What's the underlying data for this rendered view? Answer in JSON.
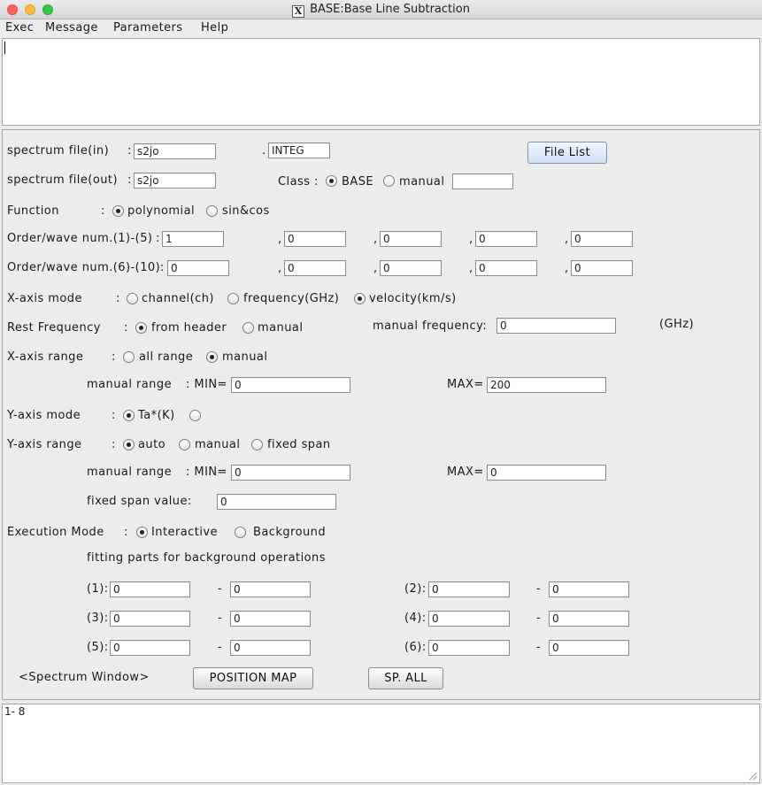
{
  "window": {
    "title": "BASE:Base Line Subtraction",
    "app_icon": "x-window-icon"
  },
  "menu": [
    "Exec",
    "Message",
    "Parameters",
    "Help"
  ],
  "log_top": "",
  "spectrum_in": {
    "label": "spectrum file(in)",
    "colon": ":",
    "value": "s2jo",
    "dot": ".",
    "ext": "INTEG"
  },
  "file_list_button": "File List",
  "spectrum_out": {
    "label": "spectrum file(out)",
    "colon": ":",
    "value": "s2jo"
  },
  "class": {
    "label": "Class :",
    "options": [
      "BASE",
      "manual"
    ],
    "selected": "BASE",
    "manual_value": ""
  },
  "function": {
    "label": "Function",
    "colon": ":",
    "options": [
      "polynomial",
      "sin&cos"
    ],
    "selected": "polynomial"
  },
  "order1": {
    "label": "Order/wave num.(1)-(5)",
    "colon": ":",
    "values": [
      "1",
      "0",
      "0",
      "0",
      "0"
    ]
  },
  "order2": {
    "label": "Order/wave num.(6)-(10)",
    "colon": ":",
    "values": [
      "0",
      "0",
      "0",
      "0",
      "0"
    ]
  },
  "comma": ",",
  "xaxis_mode": {
    "label": "X-axis mode",
    "colon": ":",
    "options": [
      "channel(ch)",
      "frequency(GHz)",
      "velocity(km/s)"
    ],
    "selected": "velocity(km/s)"
  },
  "rest_freq": {
    "label": "Rest Frequency",
    "colon": ":",
    "options": [
      "from header",
      "manual"
    ],
    "selected": "from header",
    "manual_label": "manual frequency:",
    "manual_value": "0",
    "unit": "(GHz)"
  },
  "xaxis_range": {
    "label": "X-axis range",
    "colon": ":",
    "options": [
      "all range",
      "manual"
    ],
    "selected": "manual",
    "manual_range_label": "manual range",
    "min_label": ": MIN=",
    "min": "0",
    "max_label": "MAX=",
    "max": "200"
  },
  "yaxis_mode": {
    "label": "Y-axis mode",
    "colon": ":",
    "options": [
      "Ta*(K)",
      ""
    ],
    "selected": "Ta*(K)"
  },
  "yaxis_range": {
    "label": "Y-axis range",
    "colon": ":",
    "options": [
      "auto",
      "manual",
      "fixed span"
    ],
    "selected": "auto",
    "manual_range_label": "manual range",
    "min_label": ": MIN=",
    "min": "0",
    "max_label": "MAX=",
    "max": "0",
    "fixed_span_label": "fixed span value:",
    "fixed_span": "0"
  },
  "execution": {
    "label": "Execution Mode",
    "colon": ":",
    "options": [
      "Interactive",
      "Background"
    ],
    "selected": "Interactive",
    "fitting_label": "fitting parts for background operations"
  },
  "fitting_parts": [
    {
      "label": "(1):",
      "from": "0",
      "to": "0"
    },
    {
      "label": "(2):",
      "from": "0",
      "to": "0"
    },
    {
      "label": "(3):",
      "from": "0",
      "to": "0"
    },
    {
      "label": "(4):",
      "from": "0",
      "to": "0"
    },
    {
      "label": "(5):",
      "from": "0",
      "to": "0"
    },
    {
      "label": "(6):",
      "from": "0",
      "to": "0"
    }
  ],
  "dash": "-",
  "spectrum_window": {
    "label": "<Spectrum Window>",
    "position_map": "POSITION MAP",
    "sp_all": "SP. ALL"
  },
  "log_bottom": "1- 8",
  "colors": {
    "window_bg": "#ececec",
    "field_border": "#8d8d8d",
    "button_blue": "#cfe0f5"
  }
}
